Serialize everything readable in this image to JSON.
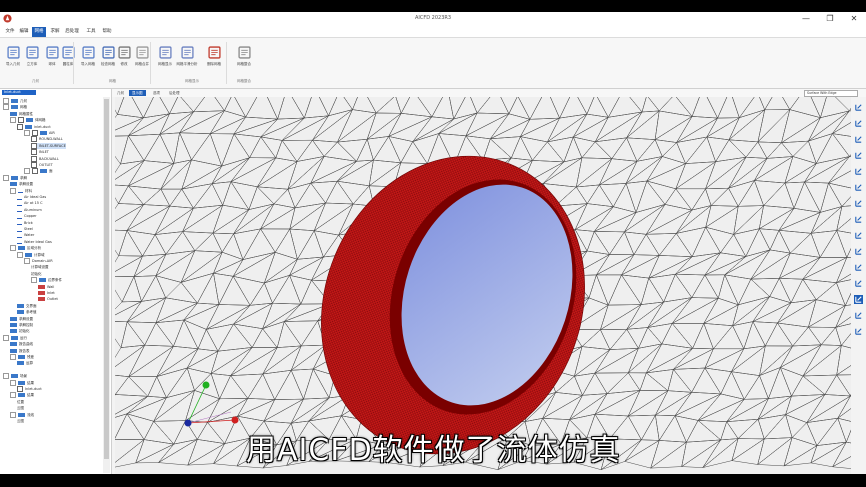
{
  "app": {
    "title": "AICFD 2023R3",
    "min": "—",
    "max": "❐",
    "close": "✕"
  },
  "menu": [
    "文件",
    "编辑",
    "网格",
    "求解",
    "后处理",
    "工具",
    "帮助"
  ],
  "menu_active": 2,
  "ribbon": {
    "buttons": [
      "导入几何",
      "立方体",
      "球体",
      "圆柱体",
      "导入网格",
      "检查网格",
      "修改",
      "网格合并",
      "网格显示",
      "网格平滑分析",
      "删除网格",
      "网格整合"
    ],
    "groups": [
      "几何",
      "网格",
      "网格显示",
      "网格整合"
    ]
  },
  "left": {
    "search": "Inlet-duct",
    "tree": [
      {
        "t": "几何",
        "d": 0,
        "tog": true,
        "ic": "folder"
      },
      {
        "t": "网格",
        "d": 0,
        "tog": true,
        "ic": "folder"
      },
      {
        "t": "网格属性",
        "d": 1,
        "ic": "folder"
      },
      {
        "t": "体网格",
        "d": 1,
        "tog": true,
        "cb": true,
        "ic": "folder"
      },
      {
        "t": "inlet-duct",
        "d": 2,
        "cb": true,
        "ic": "folder"
      },
      {
        "t": "AIR",
        "d": 3,
        "tog": true,
        "cb": true,
        "ic": "folder"
      },
      {
        "t": "ROUND-WALL",
        "d": 4,
        "cb": true
      },
      {
        "t": "INLET-SURFACE",
        "d": 4,
        "cb": true,
        "sel": true
      },
      {
        "t": "INLET",
        "d": 4,
        "cb": true
      },
      {
        "t": "BACK-WALL",
        "d": 4,
        "cb": true
      },
      {
        "t": "OUTLET",
        "d": 4,
        "cb": true
      },
      {
        "t": "面",
        "d": 3,
        "tog": true,
        "cb": true,
        "ic": "folder"
      },
      {
        "t": "求解",
        "d": 0,
        "tog": true,
        "ic": "folder"
      },
      {
        "t": "求解设置",
        "d": 1,
        "ic": "folder"
      },
      {
        "t": "材料",
        "d": 1,
        "tog": true,
        "ic": "mat"
      },
      {
        "t": "Air Ideal Gas",
        "d": 2,
        "ic": "mat"
      },
      {
        "t": "Air at 15 C",
        "d": 2,
        "ic": "mat"
      },
      {
        "t": "Aluminum",
        "d": 2,
        "ic": "mat"
      },
      {
        "t": "Copper",
        "d": 2,
        "ic": "mat"
      },
      {
        "t": "Brick",
        "d": 2,
        "ic": "mat"
      },
      {
        "t": "Steel",
        "d": 2,
        "ic": "mat"
      },
      {
        "t": "Water",
        "d": 2,
        "ic": "mat"
      },
      {
        "t": "Water Ideal Gas",
        "d": 2,
        "ic": "mat"
      },
      {
        "t": "区域分析",
        "d": 1,
        "tog": true,
        "ic": "folder"
      },
      {
        "t": "计算域",
        "d": 2,
        "tog": true,
        "ic": "folder"
      },
      {
        "t": "Domain-AIR",
        "d": 3,
        "tog": true
      },
      {
        "t": "计算域设置",
        "d": 4
      },
      {
        "t": "初始化",
        "d": 4
      },
      {
        "t": "边界条件",
        "d": 4,
        "tog": true,
        "ic": "folder"
      },
      {
        "t": "Wall",
        "d": 5,
        "ic": "red"
      },
      {
        "t": "Inlet",
        "d": 5,
        "ic": "red"
      },
      {
        "t": "Outlet",
        "d": 5,
        "ic": "red"
      },
      {
        "t": "交界面",
        "d": 2,
        "ic": "folder"
      },
      {
        "t": "参考值",
        "d": 2,
        "ic": "folder"
      },
      {
        "t": "求解设置",
        "d": 1,
        "ic": "folder"
      },
      {
        "t": "求解控制",
        "d": 1,
        "ic": "folder"
      },
      {
        "t": "初始化",
        "d": 1,
        "ic": "folder"
      },
      {
        "t": "运行",
        "d": 0,
        "tog": true,
        "ic": "folder"
      },
      {
        "t": "报告曲线",
        "d": 1,
        "ic": "folder"
      },
      {
        "t": "报告表",
        "d": 1,
        "ic": "folder"
      },
      {
        "t": "残差",
        "d": 1,
        "tog": true,
        "ic": "folder"
      },
      {
        "t": "运算",
        "d": 2,
        "ic": "folder"
      },
      {
        "t": "",
        "d": 0
      },
      {
        "t": "场景",
        "d": 0,
        "tog": true,
        "ic": "folder"
      },
      {
        "t": "结果",
        "d": 1,
        "tog": true,
        "ic": "folder"
      },
      {
        "t": "Inlet-duct",
        "d": 2,
        "cb": true
      },
      {
        "t": "结果",
        "d": 1,
        "tog": true,
        "ic": "folder"
      },
      {
        "t": "位置",
        "d": 2
      },
      {
        "t": "云图",
        "d": 2
      },
      {
        "t": "流线",
        "d": 1,
        "tog": true,
        "ic": "folder"
      },
      {
        "t": "云图",
        "d": 2
      }
    ]
  },
  "tabs": [
    "几何",
    "显示图",
    "选项",
    "后处理"
  ],
  "tab_active": 1,
  "view_dropdown": "Surface With Edge",
  "subtitle": "用AICFD软件做了流体仿真",
  "colors": {
    "accent": "#1e5eb8",
    "mesh_red": "#c41818",
    "hole_blue": "#8ea0e6"
  }
}
